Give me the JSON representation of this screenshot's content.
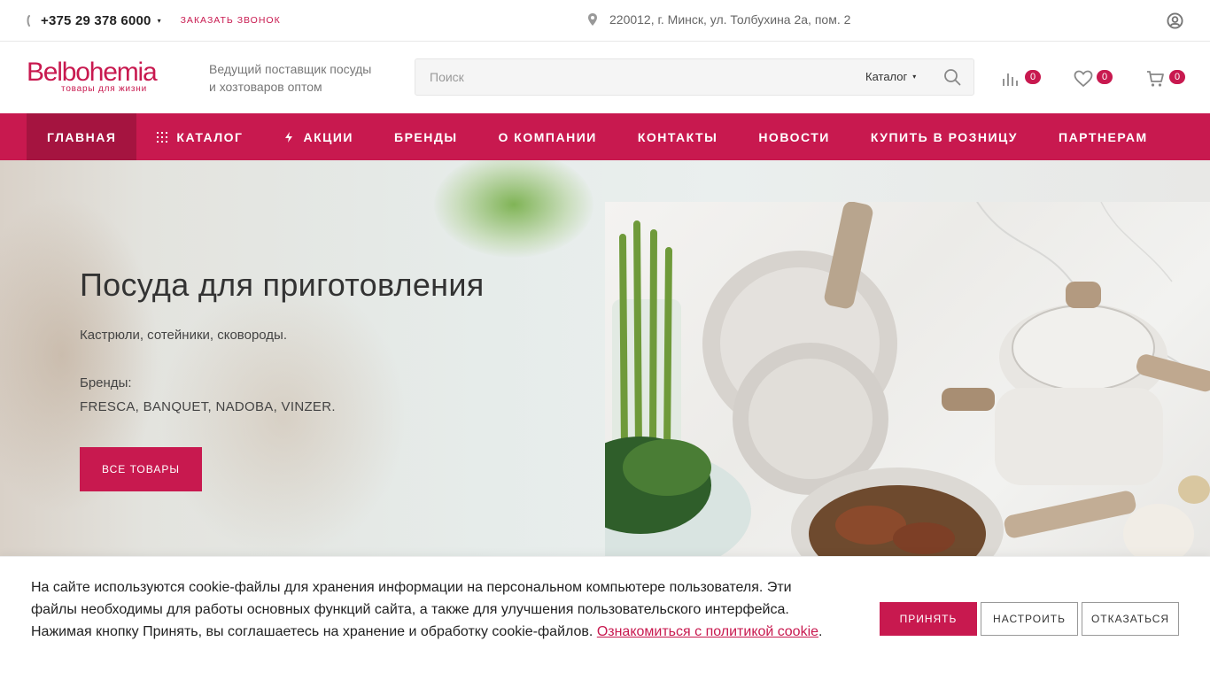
{
  "topbar": {
    "phone": "+375 29 378 6000",
    "callback": "Заказать звонок",
    "address": "220012, г. Минск, ул. Толбухина 2а, пом. 2"
  },
  "header": {
    "logo_main": "Belbohemia",
    "logo_sub": "товары для жизни",
    "slogan_line1": "Ведущий поставщик посуды",
    "slogan_line2": "и хозтоваров оптом",
    "search_placeholder": "Поиск",
    "search_category": "Каталог",
    "compare_count": "0",
    "favorites_count": "0",
    "cart_count": "0"
  },
  "nav": [
    {
      "label": "Главная",
      "icon": "none",
      "active": true
    },
    {
      "label": "Каталог",
      "icon": "grid-icon",
      "active": false
    },
    {
      "label": "Акции",
      "icon": "lightning-icon",
      "active": false
    },
    {
      "label": "Бренды",
      "icon": "none",
      "active": false
    },
    {
      "label": "О компании",
      "icon": "none",
      "active": false
    },
    {
      "label": "Контакты",
      "icon": "none",
      "active": false
    },
    {
      "label": "Новости",
      "icon": "none",
      "active": false
    },
    {
      "label": "Купить в розницу",
      "icon": "none",
      "active": false
    },
    {
      "label": "Партнерам",
      "icon": "none",
      "active": false
    }
  ],
  "hero": {
    "title": "Посуда для приготовления",
    "subtitle": "Кастрюли, сотейники, сковороды.",
    "brands_label": "Бренды:",
    "brands": "FRESCA, BANQUET, NADOBA, VINZER.",
    "button": "Все товары"
  },
  "cookie": {
    "text": "На сайте используются cookie-файлы для хранения информации на персональном компьютере пользователя. Эти файлы необходимы для работы основных функций сайта, а также для улучшения пользовательского интерфейса. Нажимая кнопку Принять, вы соглашаетесь на хранение и обработку cookie-файлов. ",
    "link": "Ознакомиться с политикой cookie",
    "accept": "Принять",
    "settings": "Настроить",
    "decline": "Отказаться"
  },
  "colors": {
    "accent": "#c8194f",
    "accent_dark": "#a51440"
  }
}
